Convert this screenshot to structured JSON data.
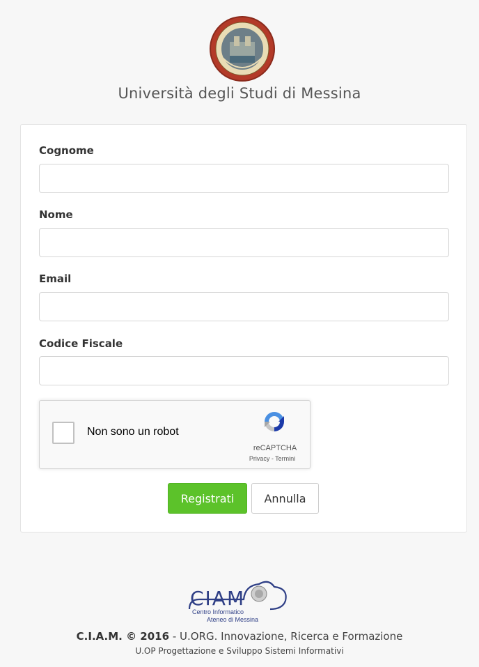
{
  "header": {
    "seal_icon": "university-seal-icon",
    "university_name": "Università degli Studi di Messina"
  },
  "form": {
    "fields": [
      {
        "label": "Cognome",
        "value": "",
        "placeholder": ""
      },
      {
        "label": "Nome",
        "value": "",
        "placeholder": ""
      },
      {
        "label": "Email",
        "value": "",
        "placeholder": ""
      },
      {
        "label": "Codice Fiscale",
        "value": "",
        "placeholder": ""
      }
    ],
    "recaptcha": {
      "label": "Non sono un robot",
      "brand": "reCAPTCHA",
      "links": "Privacy - Termini",
      "icon": "recaptcha-logo-icon"
    },
    "buttons": {
      "submit_label": "Registrati",
      "cancel_label": "Annulla"
    }
  },
  "footer": {
    "logo_text": "CIAM",
    "logo_sub1": "Centro Informatico",
    "logo_sub2": "Ateneo di Messina",
    "copyright_bold": "C.I.A.M. © 2016",
    "copyright_rest": " - U.ORG. Innovazione, Ricerca e Formazione",
    "department": "U.OP Progettazione e Sviluppo Sistemi Informativi"
  },
  "colors": {
    "primary_button": "#5cc22a",
    "background": "#f7f7f7",
    "card": "#ffffff",
    "ciam_blue": "#2f3f86"
  }
}
